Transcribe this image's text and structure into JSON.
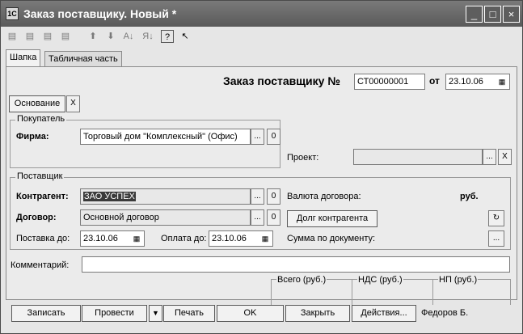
{
  "window": {
    "title": "Заказ поставщику. Новый *",
    "app_icon": "1С",
    "controls": [
      "_",
      "□",
      "×"
    ]
  },
  "toolbar": {
    "icons": [
      "add-row-icon",
      "copy-row-icon",
      "delete-row-icon",
      "edit-row-icon",
      "move-up-icon",
      "move-down-icon",
      "sort-asc-icon",
      "sort-desc-icon",
      "help-icon",
      "select-icon"
    ],
    "glyphs": [
      "▤",
      "▤",
      "▤",
      "▤",
      "⬆",
      "⬇",
      "A↓",
      "Я↓",
      "?",
      "↖"
    ]
  },
  "tabs": [
    {
      "label": "Шапка",
      "active": true
    },
    {
      "label": "Табличная часть",
      "active": false
    }
  ],
  "header": {
    "doc_title": "Заказ поставщику №",
    "doc_number": "СТ00000001",
    "date_label": "от",
    "date": "23.10.06"
  },
  "basis": {
    "label": "Основание",
    "clear": "X"
  },
  "buyer": {
    "group_label": "Покупатель",
    "firm_label": "Фирма:",
    "firm_value": "Торговый дом \"Комплексный\" (Офис)",
    "ellipsis": "...",
    "open": "0"
  },
  "project": {
    "label": "Проект:",
    "value": "",
    "ellipsis": "...",
    "clear": "X"
  },
  "supplier": {
    "group_label": "Поставщик",
    "counterparty_label": "Контрагент:",
    "counterparty_value": "ЗАО УСПЕХ",
    "contract_label": "Договор:",
    "contract_value": "Основной договор",
    "delivery_label": "Поставка до:",
    "delivery_date": "23.10.06",
    "payment_label": "Оплата до:",
    "payment_date": "23.10.06",
    "currency_label": "Валюта договора:",
    "currency_value": "руб.",
    "debt_button": "Долг контрагента",
    "sum_label": "Сумма по документу:",
    "ellipsis": "...",
    "open": "0",
    "calc": "..."
  },
  "comment": {
    "label": "Комментарий:",
    "value": ""
  },
  "totals": {
    "total_label": "Всего (руб.)",
    "vat_label": "НДС (руб.)",
    "np_label": "НП (руб.)"
  },
  "footer": {
    "save": "Записать",
    "post": "Провести",
    "post_menu": "▼",
    "print": "Печать",
    "ok": "OK",
    "close": "Закрыть",
    "actions": "Действия...",
    "user": "Федоров Б."
  }
}
